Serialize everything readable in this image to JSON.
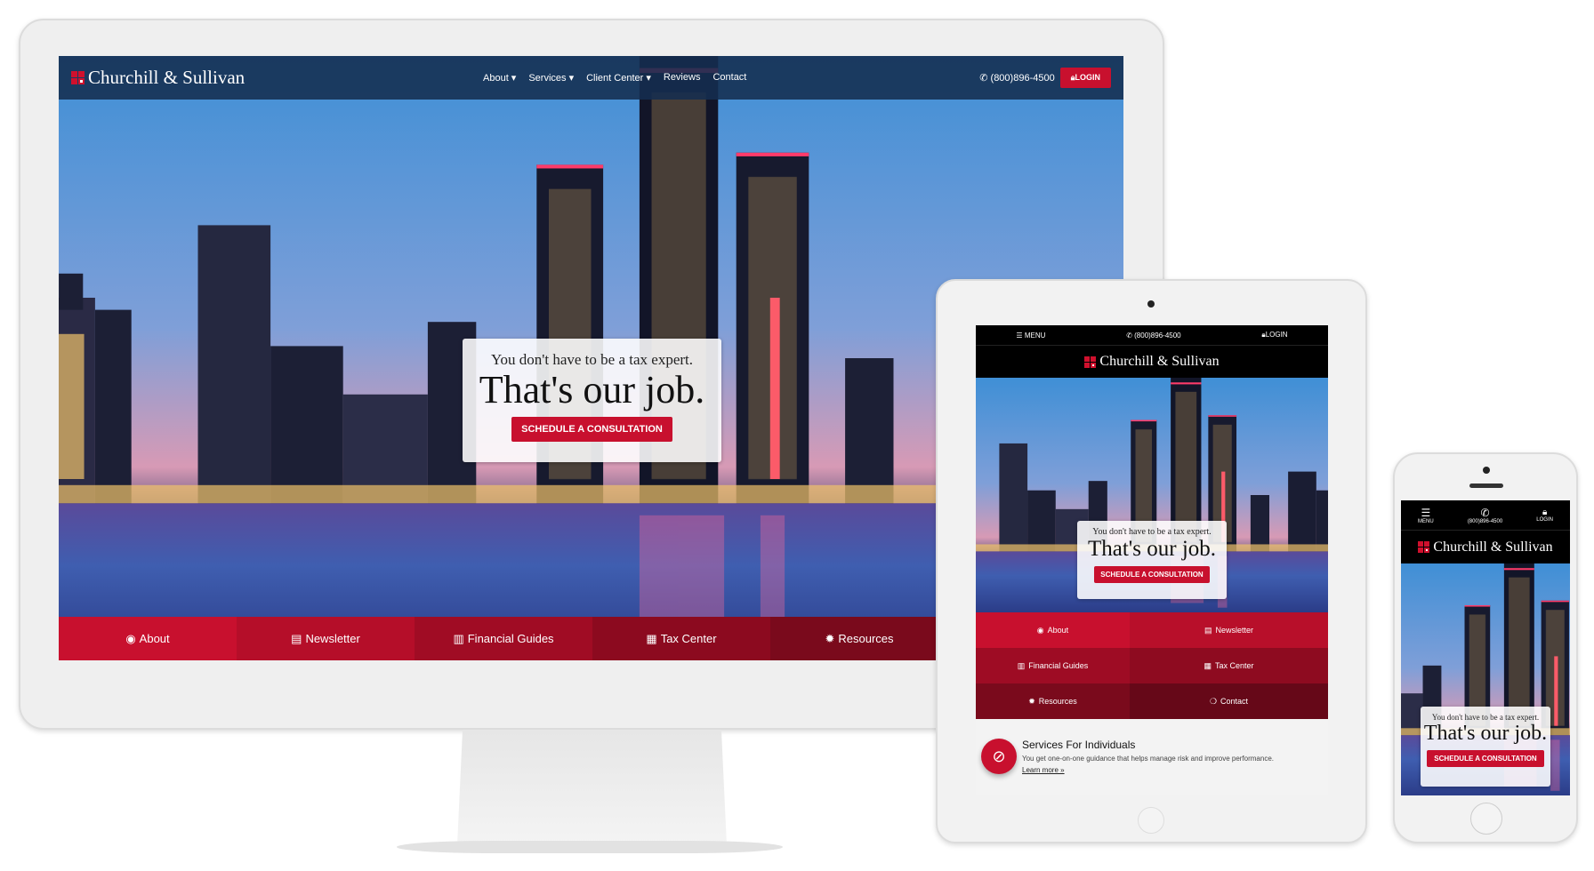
{
  "brand": {
    "name": "Churchill & Sullivan",
    "red": "#c8102e"
  },
  "desktop": {
    "nav": [
      {
        "label": "About",
        "dropdown": true
      },
      {
        "label": "Services",
        "dropdown": true
      },
      {
        "label": "Client Center",
        "dropdown": true
      },
      {
        "label": "Reviews"
      },
      {
        "label": "Contact"
      }
    ],
    "phone": "(800)896-4500",
    "login": "LOGIN",
    "hero": {
      "sub": "You don't have to be a tax expert.",
      "title": "That's our job.",
      "cta": "SCHEDULE A CONSULTATION"
    },
    "tiles": [
      {
        "label": "About",
        "icon": "user-circle-icon"
      },
      {
        "label": "Newsletter",
        "icon": "newspaper-icon"
      },
      {
        "label": "Financial Guides",
        "icon": "bar-chart-icon"
      },
      {
        "label": "Tax Center",
        "icon": "calendar-icon"
      },
      {
        "label": "Resources",
        "icon": "gear-icon"
      }
    ]
  },
  "tablet": {
    "menu": "MENU",
    "phone": "(800)896-4500",
    "login": "LOGIN",
    "tiles": [
      {
        "label": "About",
        "icon": "user-circle-icon"
      },
      {
        "label": "Newsletter",
        "icon": "newspaper-icon"
      },
      {
        "label": "Financial Guides",
        "icon": "bar-chart-icon"
      },
      {
        "label": "Tax Center",
        "icon": "calendar-icon"
      },
      {
        "label": "Resources",
        "icon": "gear-icon"
      },
      {
        "label": "Contact",
        "icon": "chat-icon"
      }
    ],
    "service": {
      "title": "Services For Individuals",
      "text": "You get one-on-one guidance that helps manage risk and improve performance.",
      "link": "Learn more »",
      "icon": "compass-icon"
    }
  },
  "mobile": {
    "menu": "MENU",
    "phone": "(800)896-4500",
    "login": "LOGIN"
  }
}
